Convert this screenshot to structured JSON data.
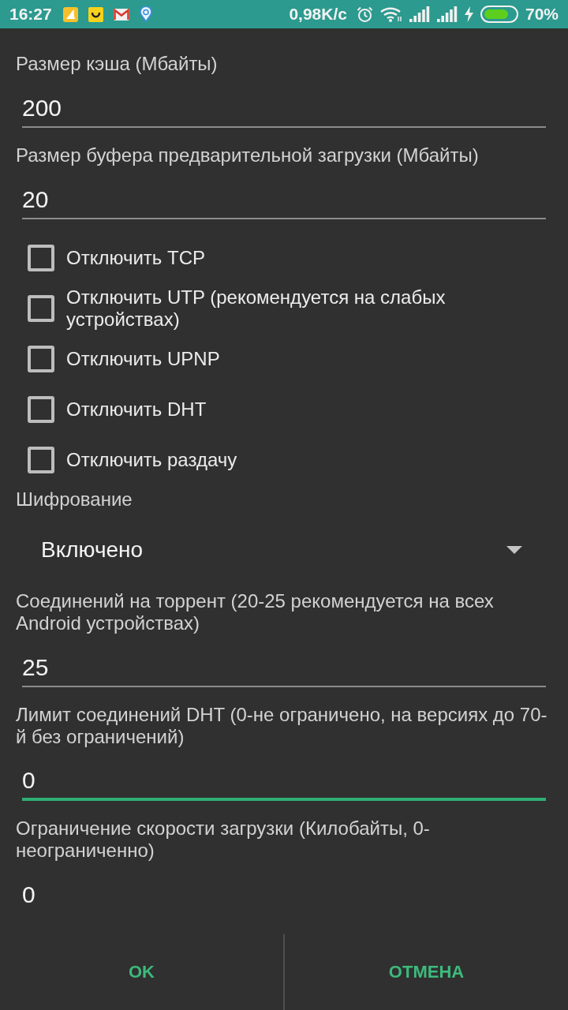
{
  "status_bar": {
    "time": "16:27",
    "network_speed": "0,98K/c",
    "battery_percent": "70%"
  },
  "settings": [
    {
      "kind": "field",
      "label": "Размер кэша (Мбайты)",
      "value": "200",
      "focused": false
    },
    {
      "kind": "field",
      "label": "Размер буфера предварительной загрузки (Мбайты)",
      "value": "20",
      "focused": false
    },
    {
      "kind": "checkbox",
      "label": "Отключить TCP",
      "checked": false
    },
    {
      "kind": "checkbox",
      "label": "Отключить UTP (рекомендуется на слабых устройствах)",
      "checked": false
    },
    {
      "kind": "checkbox",
      "label": "Отключить UPNP",
      "checked": false
    },
    {
      "kind": "checkbox",
      "label": "Отключить DHT",
      "checked": false
    },
    {
      "kind": "checkbox",
      "label": "Отключить раздачу",
      "checked": false
    },
    {
      "kind": "dropdown",
      "label": "Шифрование",
      "value": "Включено"
    },
    {
      "kind": "field",
      "label": "Соединений на торрент (20-25 рекомендуется на всех Android устройствах)",
      "value": "25",
      "focused": false
    },
    {
      "kind": "field",
      "label": "Лимит соединений DHT (0-не ограничено, на версиях до 70-й без ограничений)",
      "value": "0",
      "focused": true
    },
    {
      "kind": "field",
      "label": "Ограничение скорости загрузки (Килобайты, 0-неограниченно)",
      "value": "0",
      "focused": false
    }
  ],
  "buttons": [
    "OK",
    "ОТМЕНА"
  ]
}
